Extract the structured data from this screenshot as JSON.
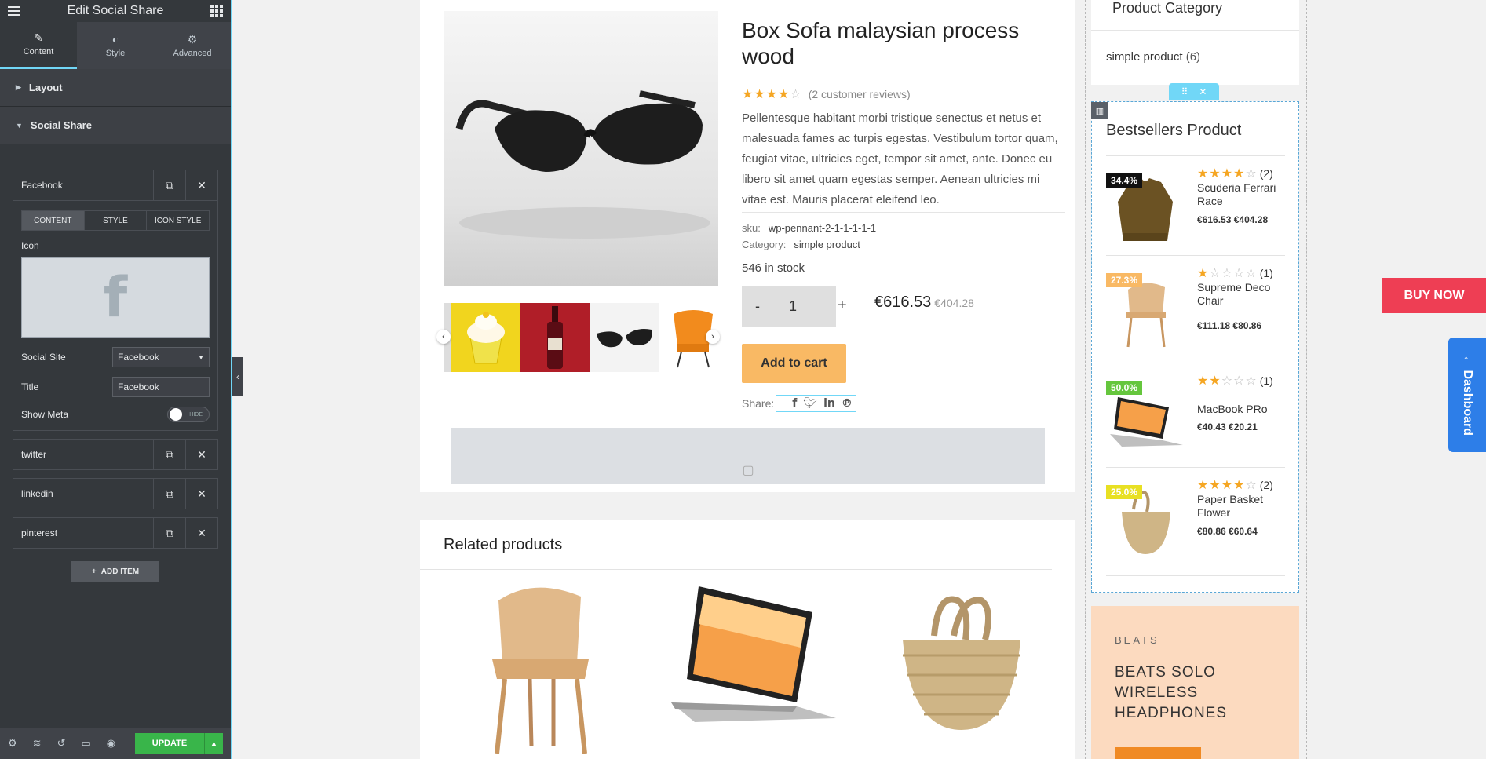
{
  "panel": {
    "title": "Edit Social Share",
    "tabs": [
      {
        "label": "Content",
        "icon": "pencil-icon"
      },
      {
        "label": "Style",
        "icon": "half-circle-icon"
      },
      {
        "label": "Advanced",
        "icon": "gear-icon"
      }
    ],
    "sections": {
      "layout": "Layout",
      "social_share": "Social Share"
    },
    "items": [
      {
        "title": "Facebook"
      },
      {
        "title": "twitter"
      },
      {
        "title": "linkedin"
      },
      {
        "title": "pinterest"
      }
    ],
    "subtabs": [
      "CONTENT",
      "STYLE",
      "ICON STYLE"
    ],
    "icon_label": "Icon",
    "social_site_label": "Social Site",
    "social_site_value": "Facebook",
    "title_label": "Title",
    "title_value": "Facebook",
    "show_meta_label": "Show Meta",
    "show_meta_state": "HIDE",
    "add_item": "ADD ITEM",
    "update": "UPDATE",
    "accent": "#71d7f7"
  },
  "product": {
    "title": "Box Sofa malaysian process wood",
    "rating": 4,
    "reviews": "(2 customer reviews)",
    "description": "Pellentesque habitant morbi tristique senectus et netus et malesuada fames ac turpis egestas. Vestibulum tortor quam, feugiat vitae, ultricies eget, tempor sit amet, ante. Donec eu libero sit amet quam egestas semper. Aenean ultricies mi vitae est. Mauris placerat eleifend leo.",
    "sku_label": "sku:",
    "sku": "wp-pennant-2-1-1-1-1-1",
    "category_label": "Category:",
    "category": "simple product",
    "stock": "546 in stock",
    "qty_minus": "-",
    "qty": "1",
    "qty_plus": "+",
    "price": "€616.53",
    "price_old": "€404.28",
    "add_to_cart": "Add to cart",
    "share_label": "Share:",
    "share_icons": [
      "facebook-icon",
      "twitter-icon",
      "linkedin-icon",
      "pinterest-icon"
    ]
  },
  "related": {
    "title": "Related products"
  },
  "sidebar": {
    "category_title": "Product Category",
    "category_item": "simple product",
    "category_count": "(6)",
    "bestsellers_title": "Bestsellers Product",
    "items": [
      {
        "badge": "34.4%",
        "badge_color": "#111111",
        "rating": 4,
        "count": "(2)",
        "name": "Scuderia Ferrari Race",
        "price": "€616.53",
        "price_old": "€404.28"
      },
      {
        "badge": "27.3%",
        "badge_color": "#f9b964",
        "rating": 1,
        "count": "(1)",
        "name": "Supreme Deco Chair",
        "price": "€111.18",
        "price_old": "€80.86"
      },
      {
        "badge": "50.0%",
        "badge_color": "#65c63d",
        "rating": 2,
        "count": "(1)",
        "name": "MacBook PRo",
        "price": "€40.43",
        "price_old": "€20.21"
      },
      {
        "badge": "25.0%",
        "badge_color": "#e8e023",
        "rating": 4,
        "count": "(2)",
        "name": "Paper Basket Flower",
        "price": "€80.86",
        "price_old": "€60.64"
      }
    ],
    "beats_brand": "BEATS",
    "beats_title": "BEATS SOLO WIRELESS HEADPHONES"
  },
  "buy_now": "BUY NOW",
  "dashboard": "← Dashboard"
}
